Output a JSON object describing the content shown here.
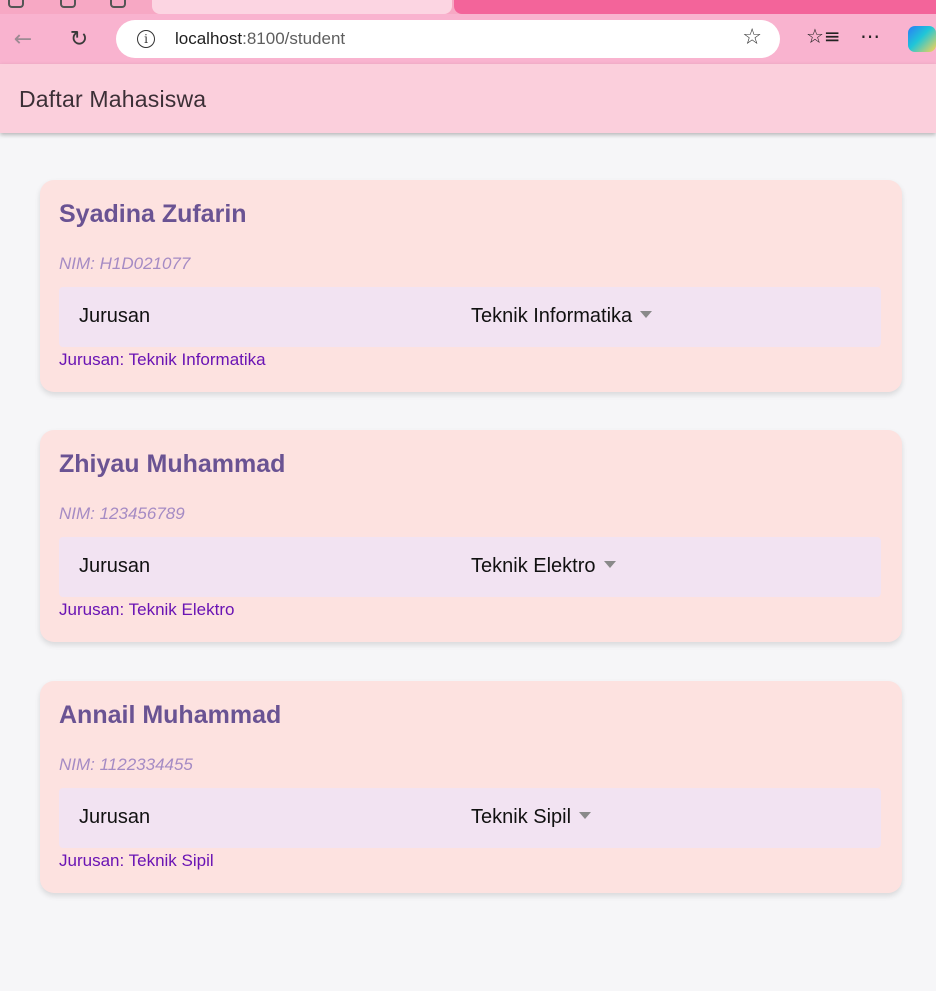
{
  "browser": {
    "url_host": "localhost",
    "url_path": ":8100/student"
  },
  "app": {
    "title": "Daftar Mahasiswa"
  },
  "students": [
    {
      "name": "Syadina Zufarin",
      "nim": "NIM: H1D021077",
      "jurusan_label": "Jurusan",
      "jurusan_value": "Teknik Informatika",
      "summary": "Jurusan: Teknik Informatika"
    },
    {
      "name": "Zhiyau Muhammad",
      "nim": "NIM: 123456789",
      "jurusan_label": "Jurusan",
      "jurusan_value": "Teknik Elektro",
      "summary": "Jurusan: Teknik Elektro"
    },
    {
      "name": "Annail Muhammad",
      "nim": "NIM: 1122334455",
      "jurusan_label": "Jurusan",
      "jurusan_value": "Teknik Sipil",
      "summary": "Jurusan: Teknik Sipil"
    }
  ],
  "icons": {
    "back": "arrow-left-icon",
    "reload": "reload-icon",
    "site_info": "info-icon",
    "favorite": "star-icon",
    "favorites": "favorites-icon",
    "more": "more-icon",
    "copilot": "copilot-icon",
    "dropdown": "chevron-down-icon"
  },
  "colors": {
    "toolbar": "#f9b3cf",
    "header": "#fbcfdc",
    "card": "#fde2e0",
    "name": "#6a5393",
    "nim": "#a58bc4",
    "select_bg": "#f2e3f2",
    "summary": "#6a14b4"
  }
}
